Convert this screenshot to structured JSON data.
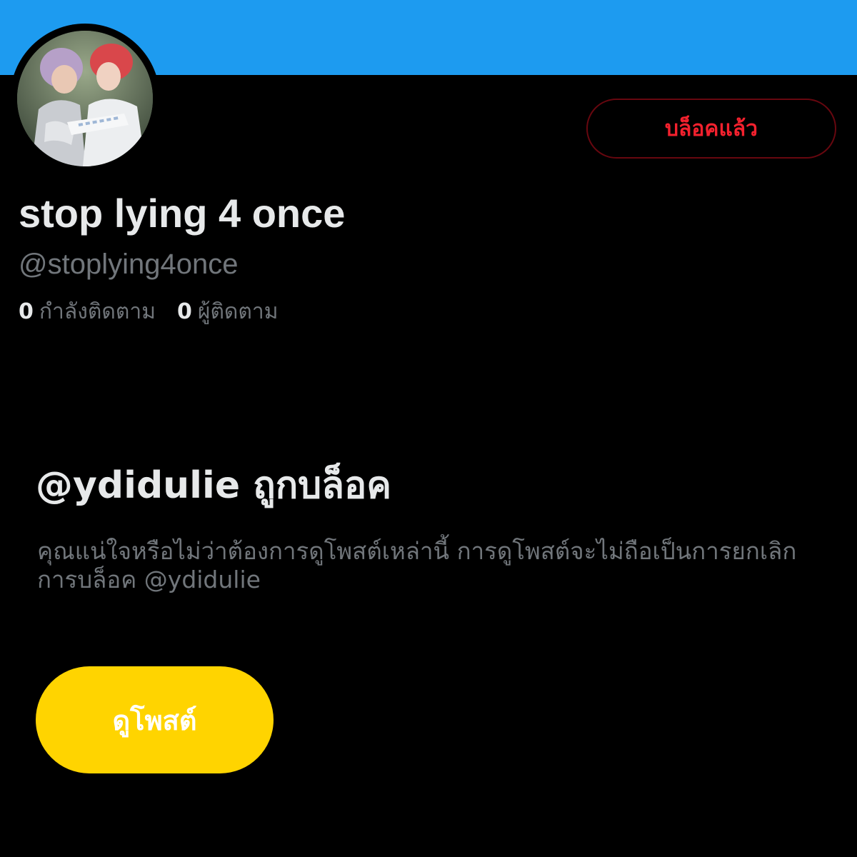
{
  "header": {
    "banner_color": "#1d9bf0"
  },
  "profile": {
    "avatar_description": "profile photo",
    "display_name": "stop lying 4 once",
    "handle": "@stoplying4once",
    "following_count": "0",
    "following_label": "กำลังติดตาม",
    "followers_count": "0",
    "followers_label": "ผู้ติดตาม",
    "blocked_button_label": "บล็อคแล้ว"
  },
  "blocked_notice": {
    "title": "@ydidulie ถูกบล็อค",
    "description": "คุณแน่ใจหรือไม่ว่าต้องการดูโพสต์เหล่านี้ การดูโพสต์จะไม่ถือเป็นการยกเลิกการบล็อค @ydidulie",
    "view_posts_label": "ดูโพสต์"
  },
  "colors": {
    "background": "#000000",
    "primary_text": "#e7e9ea",
    "secondary_text": "#71767b",
    "blocked_red": "#f4212e",
    "view_button": "#ffd400"
  }
}
